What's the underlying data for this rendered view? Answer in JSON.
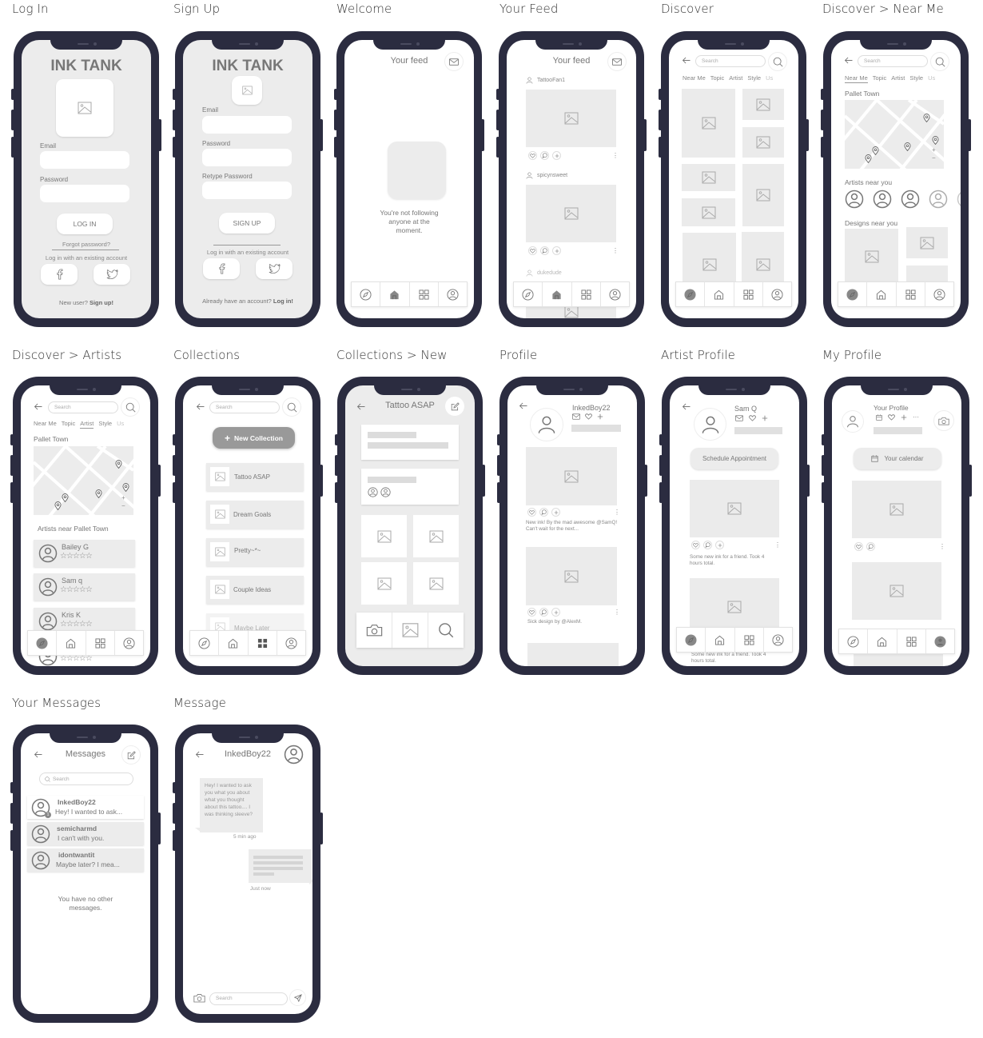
{
  "frames": [
    {
      "title": "Log In"
    },
    {
      "title": "Sign Up"
    },
    {
      "title": "Welcome"
    },
    {
      "title": "Your Feed"
    },
    {
      "title": "Discover"
    },
    {
      "title": "Discover > Near Me"
    },
    {
      "title": "Discover > Artists"
    },
    {
      "title": "Collections"
    },
    {
      "title": "Collections > New"
    },
    {
      "title": "Profile"
    },
    {
      "title": "Artist Profile"
    },
    {
      "title": "My Profile"
    },
    {
      "title": "Your Messages"
    },
    {
      "title": "Message"
    }
  ],
  "colors": {
    "phone_body": "#2b2c40",
    "screen_grey": "#ececec",
    "placeholder": "#ebebeb",
    "active_nav": "#888888"
  },
  "login": {
    "app_name": "INK TANK",
    "email_label": "Email",
    "password_label": "Password",
    "login_button": "LOG IN",
    "forgot_password": "Forgot password?",
    "existing_account": "Log in with an existing account",
    "new_user_prefix": "New user? ",
    "new_user_link": "Sign up!"
  },
  "signup": {
    "app_name": "INK TANK",
    "email_label": "Email",
    "password_label": "Password",
    "retype_label": "Retype Password",
    "signup_button": "SIGN UP",
    "existing_account": "Log in with an existing account",
    "have_account_prefix": "Already have an account? ",
    "have_account_link": "Log in!"
  },
  "welcome": {
    "header": "Your feed",
    "empty_message": "You're not following anyone at the moment."
  },
  "feed": {
    "header": "Your feed",
    "posts": [
      {
        "user": "TattooFan1"
      },
      {
        "user": "spicynsweet"
      },
      {
        "user": "dukedude"
      }
    ]
  },
  "discover": {
    "search_placeholder": "Search",
    "tabs": [
      "Near Me",
      "Topic",
      "Artist",
      "Style",
      "Us"
    ]
  },
  "near_me": {
    "search_placeholder": "Search",
    "tabs": [
      "Near Me",
      "Topic",
      "Artist",
      "Style",
      "Us"
    ],
    "active_tab": "Near Me",
    "location": "Pallet Town",
    "artists_heading": "Artists near you",
    "designs_heading": "Designs near you",
    "zoom_in": "+",
    "zoom_out": "−"
  },
  "artists": {
    "search_placeholder": "Search",
    "tabs": [
      "Near Me",
      "Topic",
      "Artist",
      "Style",
      "Us"
    ],
    "active_tab": "Artist",
    "location": "Pallet Town",
    "list_heading": "Artists near Pallet Town",
    "zoom_in": "+",
    "zoom_out": "−",
    "items": [
      {
        "name": "Bailey G",
        "stars": "☆☆☆☆☆"
      },
      {
        "name": "Sam q",
        "stars": "☆☆☆☆☆"
      },
      {
        "name": "Kris K",
        "stars": "☆☆☆☆☆"
      },
      {
        "name": "",
        "stars": "☆☆☆☆☆"
      }
    ]
  },
  "collections": {
    "search_placeholder": "Search",
    "new_button": "New Collection",
    "items": [
      "Tattoo ASAP",
      "Dream Goals",
      "Pretty~*~",
      "Couple Ideas",
      "Maybe Later"
    ]
  },
  "collection_new": {
    "title": "Tattoo ASAP"
  },
  "profile": {
    "username": "InkedBoy22",
    "posts": [
      {
        "caption": "New ink! By the mad awesome @SamQ! Can't wait for the next..."
      },
      {
        "caption": "Sick design by @AlexM."
      }
    ]
  },
  "artist_profile": {
    "name": "Sam Q",
    "schedule_button": "Schedule Appointment",
    "posts": [
      {
        "caption": "Some new ink for a friend. Took 4 hours total."
      },
      {
        "caption": "Some new ink for a friend. Took 4 hours total."
      }
    ]
  },
  "my_profile": {
    "title": "Your Profile",
    "calendar_button": "Your calendar"
  },
  "messages": {
    "title": "Messages",
    "search_placeholder": "Search",
    "threads": [
      {
        "name": "InkedBoy22",
        "preview": "Hey! I wanted to ask...",
        "unread": "1"
      },
      {
        "name": "semicharmd",
        "preview": "I can't with you."
      },
      {
        "name": "idontwantit",
        "preview": "Maybe later? I mea..."
      }
    ],
    "empty_note": "You have no other messages."
  },
  "message": {
    "contact": "InkedBoy22",
    "incoming": "Hey! I wanted to ask you what you about what you thought about this tattoo.... I was thinking sleeve?",
    "incoming_time": "5 min ago",
    "outgoing_time": "Just now",
    "input_placeholder": "Search"
  }
}
